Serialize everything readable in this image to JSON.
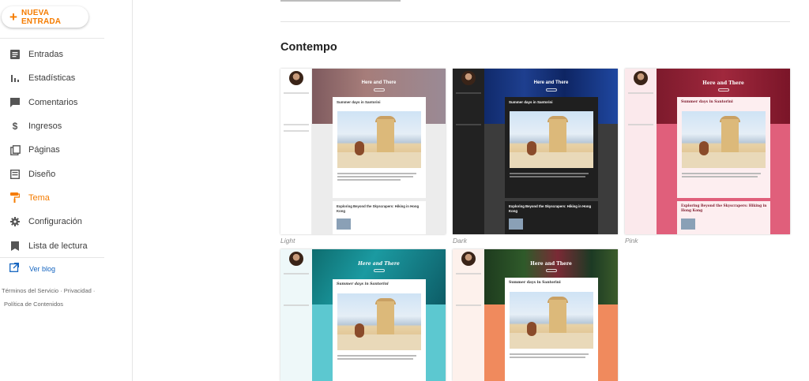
{
  "sidebar": {
    "new_entry_label": "NUEVA ENTRADA",
    "items": [
      {
        "label": "Entradas",
        "icon": "list-icon",
        "active": false
      },
      {
        "label": "Estadísticas",
        "icon": "bar-chart-icon",
        "active": false
      },
      {
        "label": "Comentarios",
        "icon": "comment-icon",
        "active": false
      },
      {
        "label": "Ingresos",
        "icon": "dollar-icon",
        "active": false
      },
      {
        "label": "Páginas",
        "icon": "pages-icon",
        "active": false
      },
      {
        "label": "Diseño",
        "icon": "layout-icon",
        "active": false
      },
      {
        "label": "Tema",
        "icon": "paint-roller-icon",
        "active": true
      },
      {
        "label": "Configuración",
        "icon": "gear-icon",
        "active": false
      },
      {
        "label": "Lista de lectura",
        "icon": "bookmark-icon",
        "active": false
      }
    ],
    "view_blog_label": "Ver blog",
    "footer": {
      "terms": "Términos del Servicio",
      "privacy": "Privacidad",
      "content_policy": "Política de Contenidos",
      "separator": "·"
    }
  },
  "colors": {
    "accent": "#f57c00",
    "link": "#1565c0",
    "text": "#212121"
  },
  "main": {
    "section_title": "Contempo",
    "themes": [
      {
        "label": "Light",
        "header_title": "Here and There",
        "post_title": "Summer days in Santorini",
        "post2_title": "Exploring Beyond the Skyscrapers: Hiking in Hong Kong"
      },
      {
        "label": "Dark",
        "header_title": "Here and There",
        "post_title": "Summer days in Santorini",
        "post2_title": "Exploring Beyond the Skyscrapers: Hiking in Hong Kong"
      },
      {
        "label": "Pink",
        "header_title": "Here and There",
        "post_title": "Summer days in Santorini",
        "post2_title": "Exploring Beyond the Skyscrapers: Hiking in Hong Kong"
      },
      {
        "label": "",
        "header_title": "Here and There",
        "post_title": "Summer days in Santorini",
        "post2_title": ""
      },
      {
        "label": "",
        "header_title": "Here and There",
        "post_title": "Summer days in Santorini",
        "post2_title": ""
      }
    ]
  }
}
